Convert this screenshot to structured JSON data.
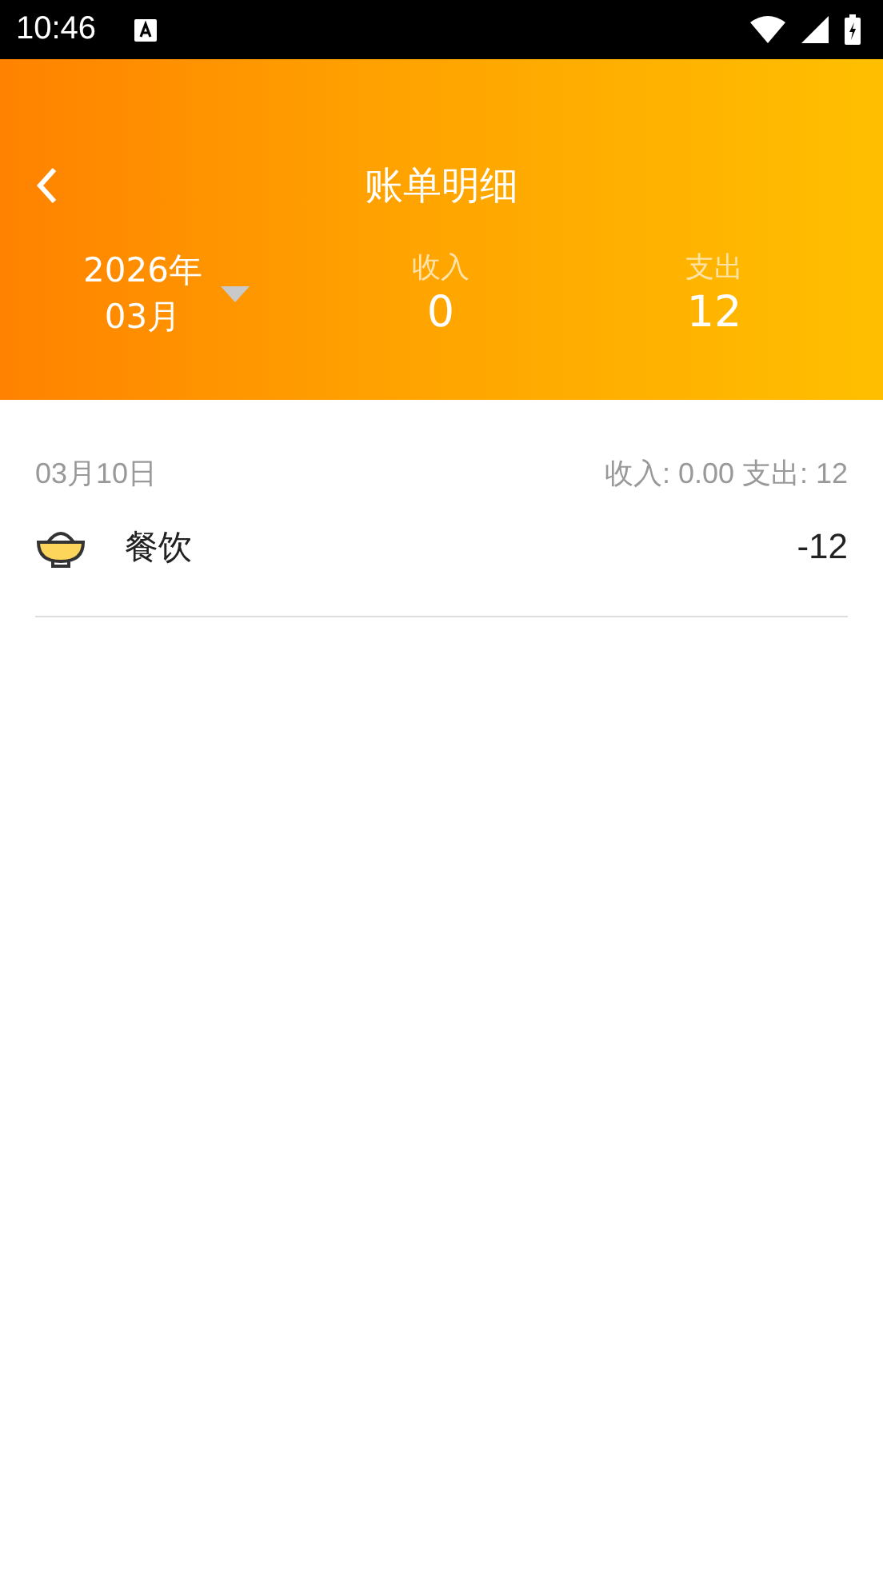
{
  "status_bar": {
    "time": "10:46"
  },
  "header": {
    "title": "账单明细",
    "year": "2026年",
    "month": "03月",
    "income_label": "收入",
    "income": "0",
    "expense_label": "支出",
    "expense": "12"
  },
  "days": [
    {
      "date": "03月10日",
      "summary": "收入: 0.00 支出: 12",
      "entries": [
        {
          "kind": "food",
          "category": "餐饮",
          "amount": "-12"
        }
      ]
    }
  ]
}
